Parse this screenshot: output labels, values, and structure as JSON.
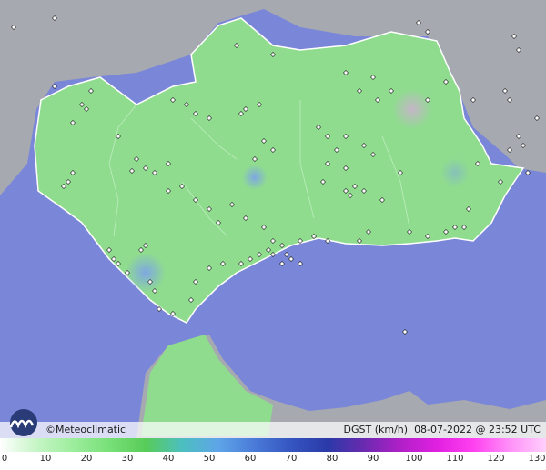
{
  "credit": "©Meteoclimatic",
  "variable_label": "DGST (km/h)",
  "timestamp": "08-07-2022 @ 23:52 UTC",
  "colors": {
    "sea": "#7a86d8",
    "land_foreign": "#a9acb2",
    "wind_low": "#8fdc8f",
    "gust_blue": "#7fa6e0",
    "calm": "#b8b8c4"
  },
  "scale": {
    "labels": [
      "0",
      "10",
      "20",
      "30",
      "40",
      "50",
      "60",
      "70",
      "80",
      "90",
      "100",
      "110",
      "120",
      "130"
    ],
    "colors": [
      "#ffffff",
      "#c6f5c6",
      "#9ded9d",
      "#78e078",
      "#58cc58",
      "#4cbfbf",
      "#5ea5e8",
      "#4a7ad8",
      "#3555c0",
      "#2a3aa8",
      "#6a2ab0",
      "#b020c8",
      "#e020e0",
      "#ff40f0",
      "#ff90f8",
      "#ffd0fc"
    ]
  }
}
